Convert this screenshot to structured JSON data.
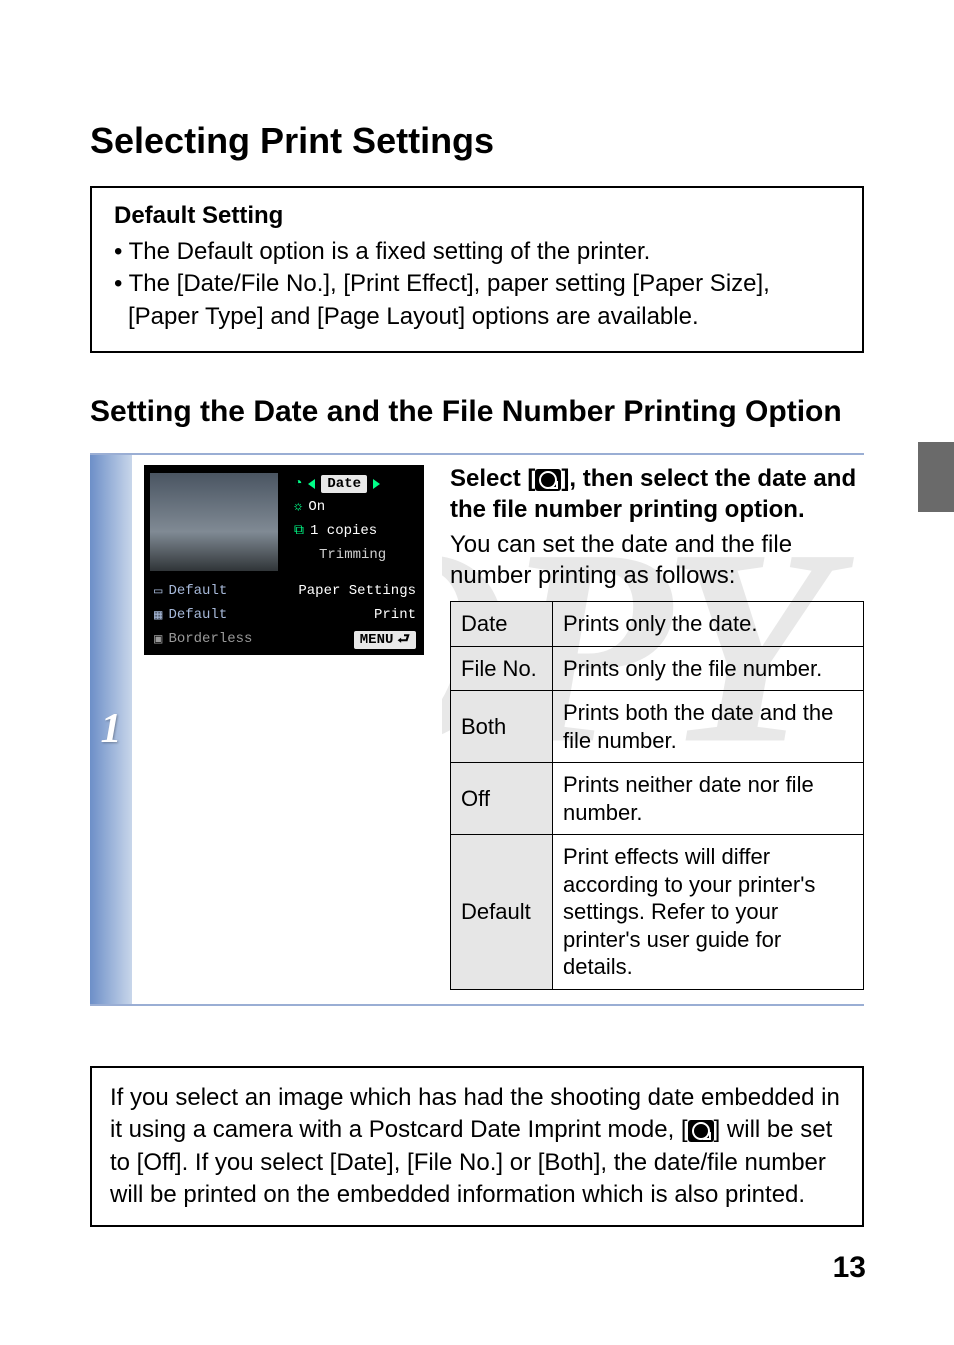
{
  "watermark": "COPY",
  "heading": "Selecting Print Settings",
  "default_box": {
    "title": "Default Setting",
    "line1": "• The Default option is a fixed setting of the printer.",
    "line2": "• The [Date/File No.], [Print Effect], paper setting [Paper Size], [Paper Type] and [Page Layout] options are available."
  },
  "subheading": "Setting the Date and the File Number Printing Option",
  "step_number": "1",
  "camera_screen": {
    "selected": "Date",
    "on": "On",
    "copies": "1 copies",
    "trimming": "Trimming",
    "default1": "Default",
    "default2": "Default",
    "borderless": "Borderless",
    "paper_settings": "Paper Settings",
    "print": "Print",
    "menu": "MENU"
  },
  "instruction": {
    "prefix": "Select [",
    "mid": "], then select the date and the file number printing option.",
    "body": "You can set the date and the file number printing as follows:"
  },
  "options_table": [
    {
      "label": "Date",
      "desc": "Prints only the date."
    },
    {
      "label": "File No.",
      "desc": "Prints only the file number."
    },
    {
      "label": "Both",
      "desc": "Prints both the date and the file number."
    },
    {
      "label": "Off",
      "desc": "Prints neither date nor file number."
    },
    {
      "label": "Default",
      "desc": "Print effects will differ according to your printer's settings. Refer to your printer's user guide for details."
    }
  ],
  "note": {
    "part1": "If you select an image which has had the shooting date embedded in it using a camera with a Postcard Date Imprint mode, [",
    "part2": "] will be set to [Off]. If you select [Date], [File No.] or [Both], the date/file number will be printed on the embedded information which is also printed."
  },
  "page_number": "13"
}
